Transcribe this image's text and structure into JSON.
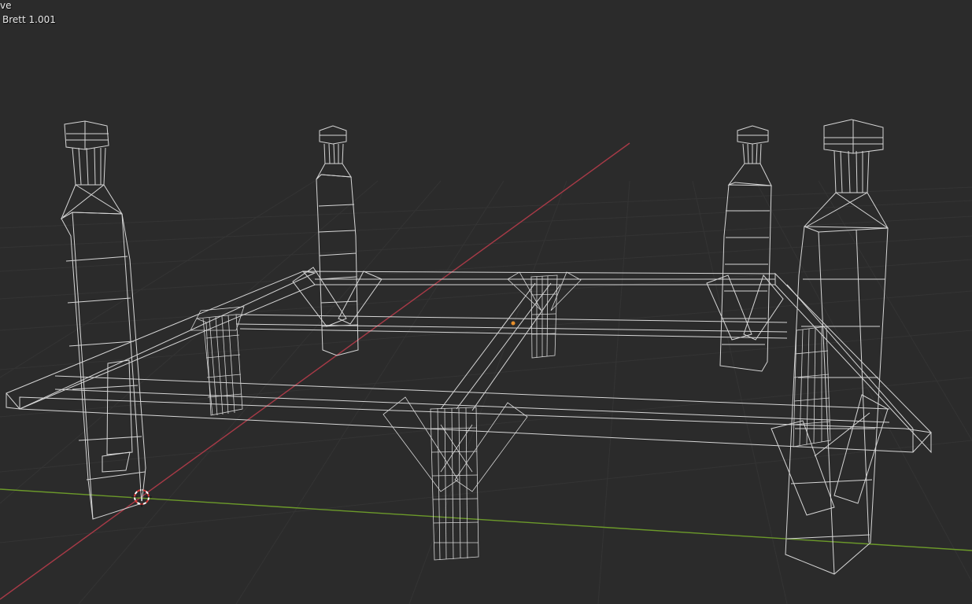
{
  "viewport": {
    "mode_text": "ve",
    "object_text": "Brett 1.001",
    "shading": "wireframe",
    "colors": {
      "background": "#2b2b2b",
      "grid": "#353535",
      "x_axis": "#a83a47",
      "y_axis": "#6c9a2a",
      "wire": "#d6d6d6",
      "origin": "#e8902c",
      "cursor_red": "#d83a3a",
      "cursor_white": "#ffffff"
    }
  }
}
